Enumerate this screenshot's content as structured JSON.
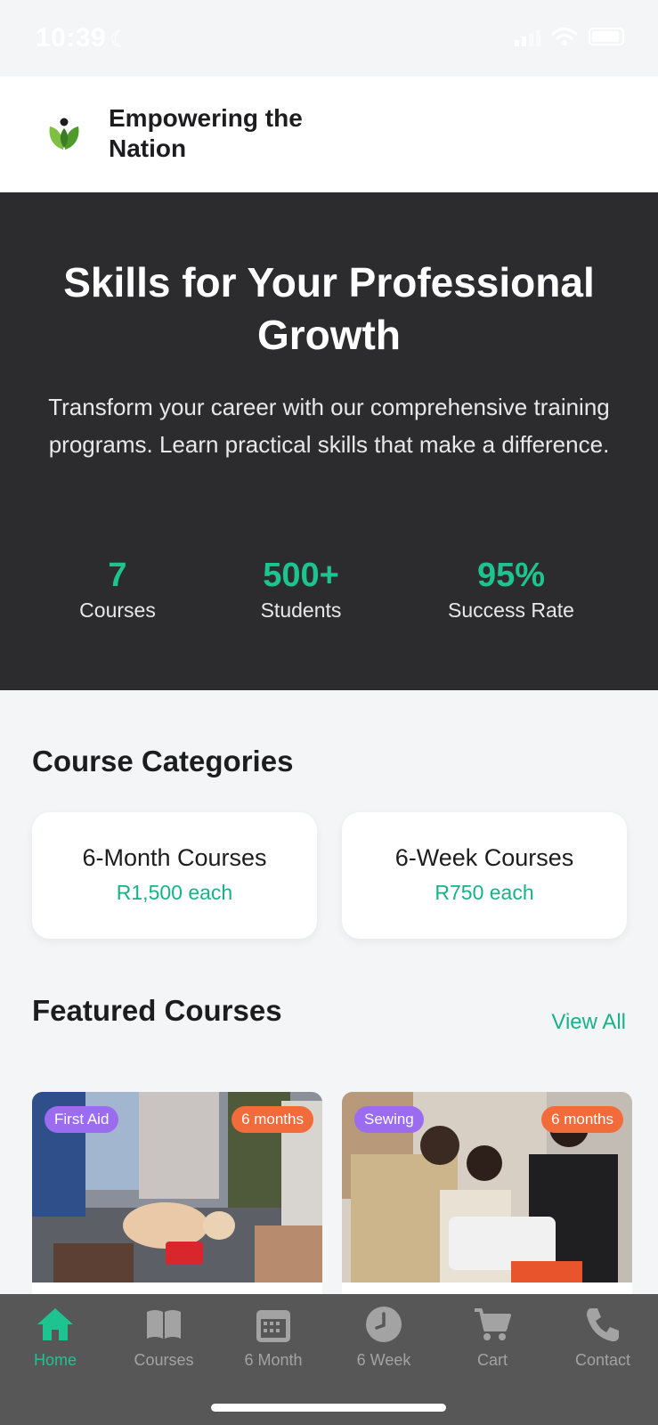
{
  "status_bar": {
    "time": "10:39",
    "moon": "☾"
  },
  "header": {
    "brand": "Empowering the Nation",
    "logo_icon": "leaf-person-icon"
  },
  "hero": {
    "title": "Skills for Your Professional Growth",
    "subtitle": "Transform your career with our comprehensive training programs. Learn practical skills that make a difference.",
    "stats": [
      {
        "value": "7",
        "label": "Courses"
      },
      {
        "value": "500+",
        "label": "Students"
      },
      {
        "value": "95%",
        "label": "Success Rate"
      }
    ]
  },
  "categories": {
    "title": "Course Categories",
    "items": [
      {
        "name": "6-Month Courses",
        "price": "R1,500 each"
      },
      {
        "name": "6-Week Courses",
        "price": "R750 each"
      }
    ]
  },
  "featured": {
    "title": "Featured Courses",
    "view_all": "View All",
    "courses": [
      {
        "category": "First Aid",
        "duration": "6 months"
      },
      {
        "category": "Sewing",
        "duration": "6 months"
      }
    ]
  },
  "tabs": [
    {
      "label": "Home",
      "icon": "home-icon",
      "active": true
    },
    {
      "label": "Courses",
      "icon": "book-icon",
      "active": false
    },
    {
      "label": "6 Month",
      "icon": "calendar-icon",
      "active": false
    },
    {
      "label": "6 Week",
      "icon": "clock-icon",
      "active": false
    },
    {
      "label": "Cart",
      "icon": "cart-icon",
      "active": false
    },
    {
      "label": "Contact",
      "icon": "phone-icon",
      "active": false
    }
  ],
  "colors": {
    "accent": "#1ec48f",
    "hero_bg": "#2c2c2e",
    "badge_category": "#9b6cf0",
    "badge_duration": "#f26b3a",
    "tab_bar": "#575757"
  }
}
